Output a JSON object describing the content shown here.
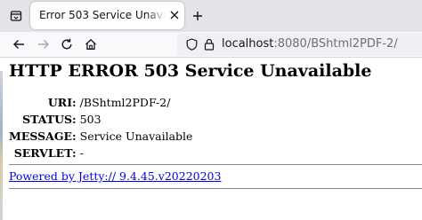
{
  "browser": {
    "tab": {
      "title": "Error 503 Service Unavailable"
    },
    "url": {
      "host": "localhost",
      "rest": ":8080/BShtml2PDF-2/"
    }
  },
  "page": {
    "title": "HTTP ERROR 503 Service Unavailable",
    "rows": [
      {
        "label": "URI:",
        "value": "/BShtml2PDF-2/"
      },
      {
        "label": "STATUS:",
        "value": "503"
      },
      {
        "label": "MESSAGE:",
        "value": "Service Unavailable"
      },
      {
        "label": "SERVLET:",
        "value": "-"
      }
    ],
    "footer_link": "Powered by Jetty:// 9.4.45.v20220203"
  },
  "colors": {
    "link": "#0000ee",
    "tabbar_bg": "#e5e3ea",
    "urlbar_bg": "#f0f0f4"
  },
  "icons": [
    "tab-list-icon",
    "close-icon",
    "plus-icon",
    "back-arrow-icon",
    "forward-arrow-icon",
    "reload-icon",
    "home-icon",
    "shield-icon",
    "lock-icon"
  ]
}
